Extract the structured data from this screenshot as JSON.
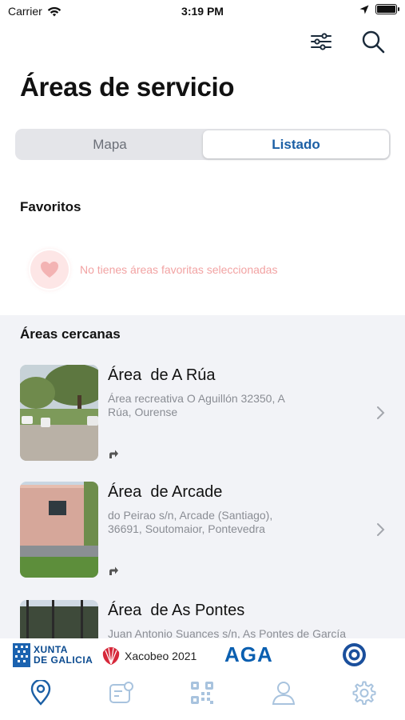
{
  "status_bar": {
    "carrier": "Carrier",
    "time": "3:19 PM"
  },
  "header": {
    "title": "Áreas de servicio"
  },
  "segmented": {
    "options": [
      "Mapa",
      "Listado"
    ],
    "selected": "Listado"
  },
  "favorites": {
    "title": "Favoritos",
    "empty_text": "No tienes áreas favoritas seleccionadas"
  },
  "nearby": {
    "title": "Áreas cercanas",
    "items": [
      {
        "name": "Área  de A Rúa",
        "address": "Área recreativa O Aguillón 32350, A Rúa, Ourense"
      },
      {
        "name": "Área  de Arcade",
        "address": "do Peirao s/n, Arcade (Santiago), 36691, Soutomaior, Pontevedra"
      },
      {
        "name": "Área  de As Pontes",
        "address": "Juan Antonio Suances s/n, As Pontes de García"
      }
    ]
  },
  "sponsors": {
    "xunta_line1": "XUNTA",
    "xunta_line2": "DE GALICIA",
    "xacobeo": "Xacobeo 2021",
    "aga": "AGA"
  },
  "tab_bar": {
    "items": [
      "map-pin-icon",
      "card-icon",
      "qr-code-icon",
      "profile-icon",
      "settings-icon"
    ],
    "active": "map-pin-icon"
  },
  "colors": {
    "accent": "#1b5fa5",
    "favorite_empty": "#f2a3a3",
    "section_bg": "#f2f3f7"
  }
}
